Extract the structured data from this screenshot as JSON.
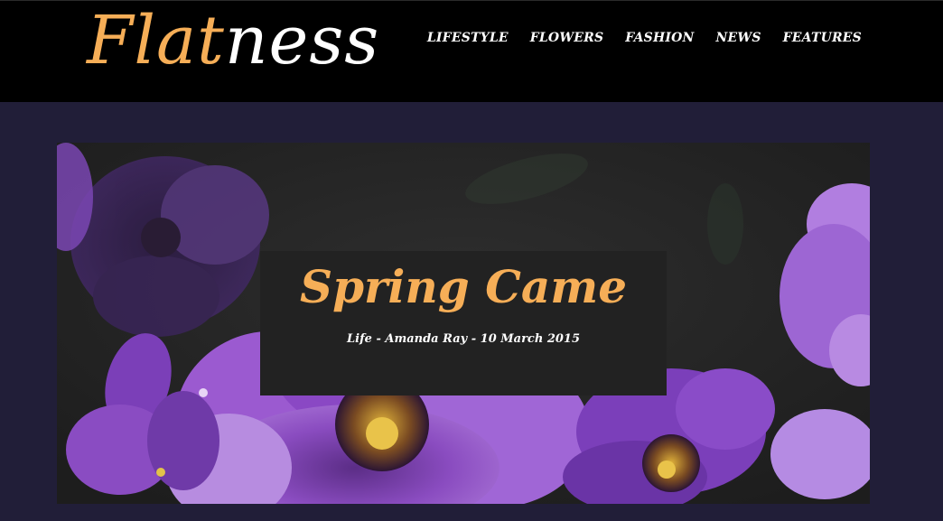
{
  "logo": {
    "part1": "Flat",
    "part2": "ness"
  },
  "nav": [
    "LIFESTYLE",
    "FLOWERS",
    "FASHION",
    "NEWS",
    "FEATURES"
  ],
  "hero": {
    "title": "Spring Came",
    "meta": "Life - Amanda Ray - 10 March 2015",
    "image": "purple-petunia-flowers"
  },
  "colors": {
    "accent": "#f6ae57",
    "page_bg": "#211e38",
    "header_bg": "#000000",
    "caption_bg": "#222222"
  }
}
